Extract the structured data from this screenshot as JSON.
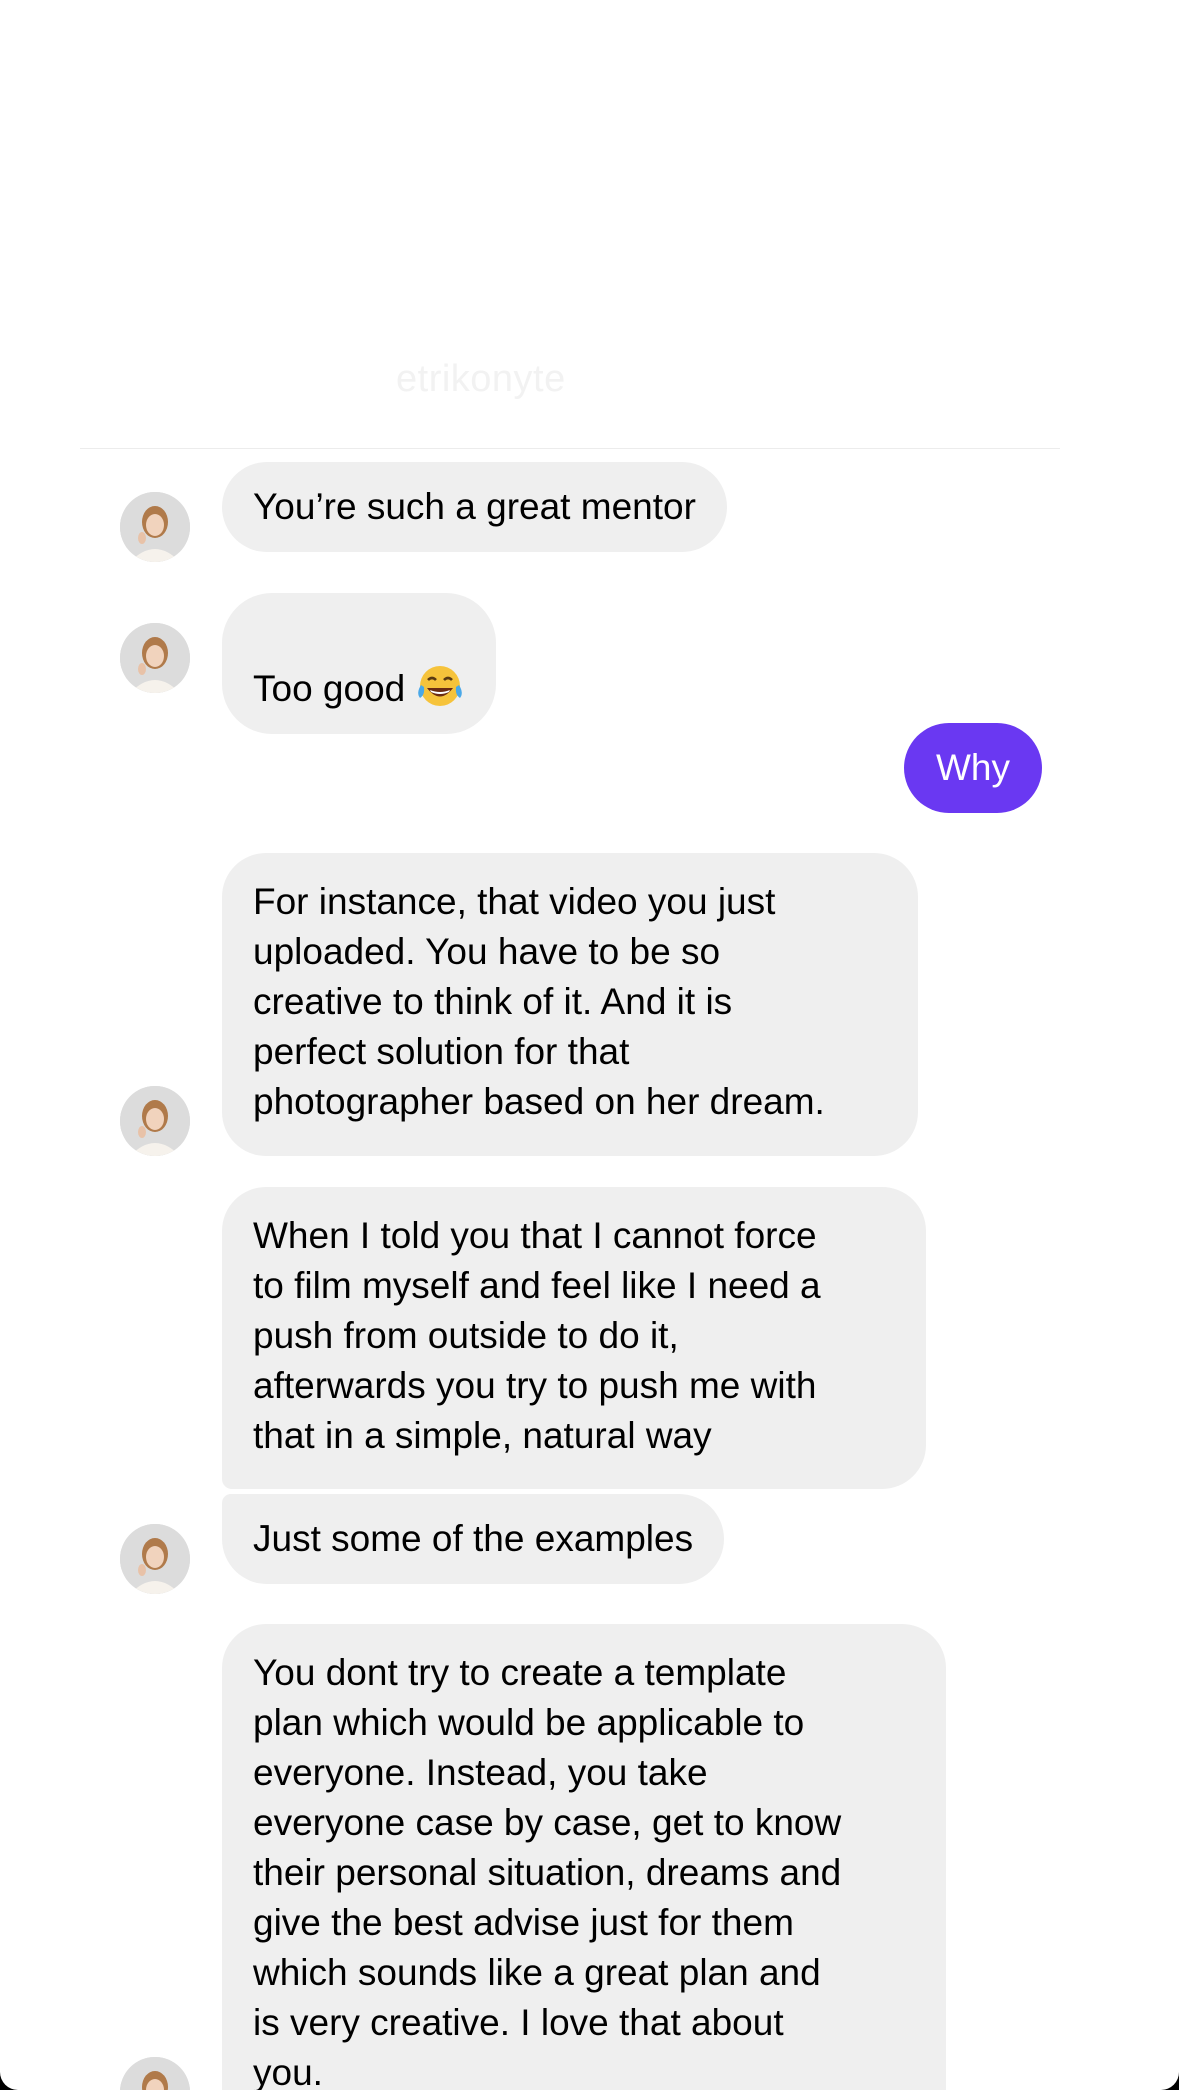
{
  "header": {
    "username_partial": "etrikonyte"
  },
  "messages": [
    {
      "sender": "them",
      "text": "You’re such a great mentor"
    },
    {
      "sender": "them",
      "text": "Too good",
      "emoji": "face-with-tears-of-joy"
    },
    {
      "sender": "me",
      "text": "Why"
    },
    {
      "sender": "them",
      "text": "For instance, that video you just\nuploaded. You have to be so\ncreative to think of it. And it is\nperfect solution for that\nphotographer based on her dream."
    },
    {
      "sender": "them",
      "text": "When I told you that I cannot force\nto film myself and feel like I need a\npush from outside to do it,\nafterwards you try to push me with\nthat in a simple, natural way"
    },
    {
      "sender": "them",
      "text": "Just some of the examples"
    },
    {
      "sender": "them",
      "text": "You dont try to create a template\nplan which would be applicable to\neveryone. Instead, you take\neveryone case by case, get to know\ntheir personal situation, dreams and\ngive the best advise just for them\nwhich sounds like a great plan and\nis very creative. I love that about\nyou."
    }
  ],
  "colors": {
    "sent_bubble": "#6a38f2",
    "received_bubble": "#efefef",
    "background": "#ffffff"
  }
}
